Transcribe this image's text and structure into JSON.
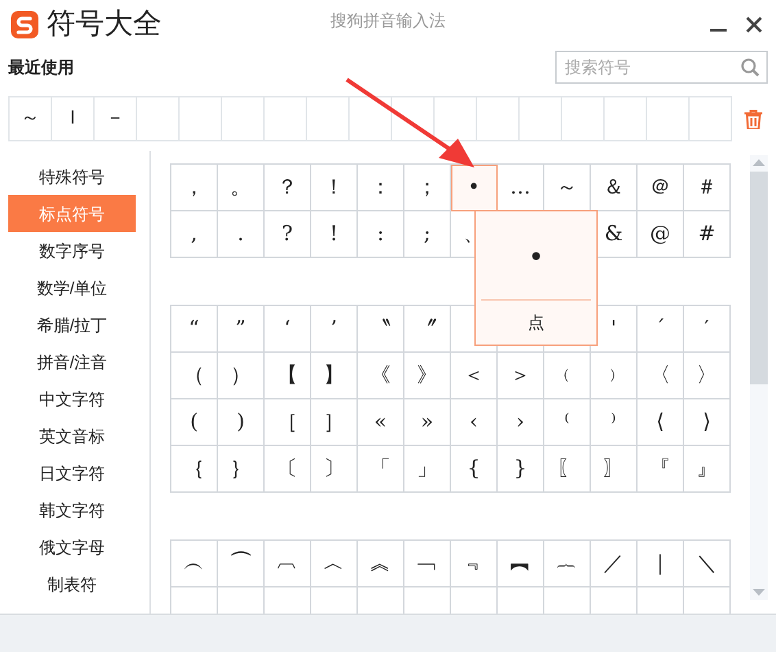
{
  "window": {
    "title": "符号大全",
    "app_name": "搜狗拼音输入法"
  },
  "recent": {
    "label": "最近使用",
    "symbols": [
      "～",
      "Ｉ",
      "－"
    ]
  },
  "search": {
    "placeholder": "搜索符号"
  },
  "categories": [
    {
      "label": "特殊符号",
      "selected": false
    },
    {
      "label": "标点符号",
      "selected": true
    },
    {
      "label": "数字序号",
      "selected": false
    },
    {
      "label": "数学/单位",
      "selected": false
    },
    {
      "label": "希腊/拉丁",
      "selected": false
    },
    {
      "label": "拼音/注音",
      "selected": false
    },
    {
      "label": "中文字符",
      "selected": false
    },
    {
      "label": "英文音标",
      "selected": false
    },
    {
      "label": "日文字符",
      "selected": false
    },
    {
      "label": "韩文字符",
      "selected": false
    },
    {
      "label": "俄文字母",
      "selected": false
    },
    {
      "label": "制表符",
      "selected": false
    }
  ],
  "groups": [
    {
      "rows": [
        [
          {
            "symbol": "，",
            "selected": false
          },
          {
            "symbol": "。",
            "selected": false
          },
          {
            "symbol": "？",
            "selected": false
          },
          {
            "symbol": "！",
            "selected": false
          },
          {
            "symbol": "：",
            "selected": false
          },
          {
            "symbol": "；",
            "selected": false
          },
          {
            "symbol": "•",
            "selected": true
          },
          {
            "symbol": "…",
            "selected": false
          },
          {
            "symbol": "～",
            "selected": false
          },
          {
            "symbol": "＆",
            "selected": false
          },
          {
            "symbol": "＠",
            "selected": false
          },
          {
            "symbol": "＃",
            "selected": false
          }
        ],
        [
          {
            "symbol": ",",
            "selected": false
          },
          {
            "symbol": ".",
            "selected": false
          },
          {
            "symbol": "?",
            "selected": false
          },
          {
            "symbol": "!",
            "selected": false
          },
          {
            "symbol": ":",
            "selected": false
          },
          {
            "symbol": ";",
            "selected": false
          },
          {
            "symbol": "、",
            "selected": false
          },
          {},
          {},
          {
            "symbol": "&",
            "selected": false
          },
          {
            "symbol": "@",
            "selected": false
          },
          {
            "symbol": "#",
            "selected": false
          }
        ]
      ]
    },
    {
      "rows": [
        [
          {
            "symbol": "“",
            "selected": false
          },
          {
            "symbol": "”",
            "selected": false
          },
          {
            "symbol": "‘",
            "selected": false
          },
          {
            "symbol": "’",
            "selected": false
          },
          {
            "symbol": "〝",
            "selected": false
          },
          {
            "symbol": "〞",
            "selected": false
          },
          {},
          {},
          {},
          {
            "symbol": "'",
            "selected": false
          },
          {
            "symbol": "ˊ",
            "selected": false
          },
          {
            "symbol": "′",
            "selected": false
          }
        ],
        [
          {
            "symbol": "（",
            "selected": false
          },
          {
            "symbol": "）",
            "selected": false
          },
          {
            "symbol": "【",
            "selected": false
          },
          {
            "symbol": "】",
            "selected": false
          },
          {
            "symbol": "《",
            "selected": false
          },
          {
            "symbol": "》",
            "selected": false
          },
          {
            "symbol": "＜",
            "selected": false
          },
          {
            "symbol": "＞",
            "selected": false
          },
          {
            "symbol": "﹙",
            "selected": false
          },
          {
            "symbol": "﹚",
            "selected": false
          },
          {
            "symbol": "〈",
            "selected": false
          },
          {
            "symbol": "〉",
            "selected": false
          }
        ],
        [
          {
            "symbol": "(",
            "selected": false
          },
          {
            "symbol": ")",
            "selected": false
          },
          {
            "symbol": "［",
            "selected": false
          },
          {
            "symbol": "］",
            "selected": false
          },
          {
            "symbol": "«",
            "selected": false
          },
          {
            "symbol": "»",
            "selected": false
          },
          {
            "symbol": "‹",
            "selected": false
          },
          {
            "symbol": "›",
            "selected": false
          },
          {
            "symbol": "⁽",
            "selected": false
          },
          {
            "symbol": "⁾",
            "selected": false
          },
          {
            "symbol": "⟨",
            "selected": false
          },
          {
            "symbol": "⟩",
            "selected": false
          }
        ],
        [
          {
            "symbol": "｛",
            "selected": false
          },
          {
            "symbol": "｝",
            "selected": false
          },
          {
            "symbol": "〔",
            "selected": false
          },
          {
            "symbol": "〕",
            "selected": false
          },
          {
            "symbol": "「",
            "selected": false
          },
          {
            "symbol": "」",
            "selected": false
          },
          {
            "symbol": "{",
            "selected": false
          },
          {
            "symbol": "}",
            "selected": false
          },
          {
            "symbol": "〖",
            "selected": false
          },
          {
            "symbol": "〗",
            "selected": false
          },
          {
            "symbol": "『",
            "selected": false
          },
          {
            "symbol": "』",
            "selected": false
          }
        ]
      ]
    },
    {
      "rows": [
        [
          {
            "symbol": "︵",
            "selected": false
          },
          {
            "symbol": "⏜",
            "selected": false
          },
          {
            "symbol": "︹",
            "selected": false
          },
          {
            "symbol": "︿",
            "selected": false
          },
          {
            "symbol": "︽",
            "selected": false
          },
          {
            "symbol": "﹁",
            "selected": false
          },
          {
            "symbol": "﹃",
            "selected": false
          },
          {
            "symbol": "︻",
            "selected": false
          },
          {
            "symbol": "︷",
            "selected": false
          },
          {
            "symbol": "／",
            "selected": false
          },
          {
            "symbol": "｜",
            "selected": false
          },
          {
            "symbol": "＼",
            "selected": false
          }
        ],
        [
          {},
          {},
          {},
          {},
          {},
          {},
          {},
          {},
          {},
          {},
          {},
          {}
        ]
      ]
    }
  ],
  "popup": {
    "symbol": "•",
    "name": "点"
  }
}
